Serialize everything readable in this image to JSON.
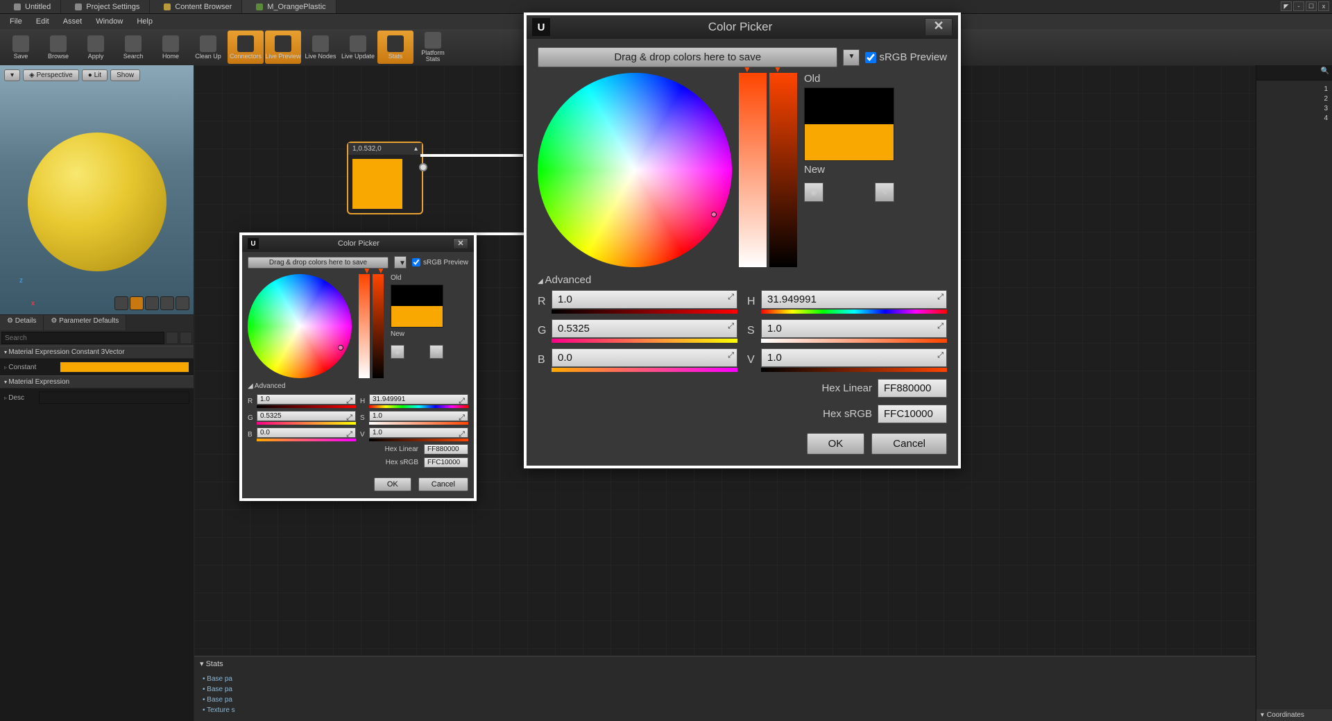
{
  "tabs": [
    {
      "label": "Untitled"
    },
    {
      "label": "Project Settings"
    },
    {
      "label": "Content Browser"
    },
    {
      "label": "M_OrangePlastic"
    }
  ],
  "menu": [
    "File",
    "Edit",
    "Asset",
    "Window",
    "Help"
  ],
  "toolbar": [
    {
      "label": "Save"
    },
    {
      "label": "Browse"
    },
    {
      "label": "Apply"
    },
    {
      "label": "Search"
    },
    {
      "label": "Home"
    },
    {
      "label": "Clean Up"
    },
    {
      "label": "Connectors",
      "active": true
    },
    {
      "label": "Live Preview",
      "active": true
    },
    {
      "label": "Live Nodes"
    },
    {
      "label": "Live Update"
    },
    {
      "label": "Stats",
      "active": true
    },
    {
      "label": "Platform Stats"
    }
  ],
  "viewport": {
    "perspective": "Perspective",
    "lit": "Lit",
    "show": "Show"
  },
  "detailsTabs": [
    "Details",
    "Parameter Defaults"
  ],
  "search_placeholder": "Search",
  "sections": {
    "vec3": "Material Expression Constant 3Vector",
    "constant": "Constant",
    "expr": "Material Expression",
    "desc": "Desc"
  },
  "node": {
    "title": "1,0.532,0"
  },
  "stats": {
    "header": "Stats",
    "items": [
      "Base pa",
      "Base pa",
      "Base pa",
      "Texture s"
    ]
  },
  "right": {
    "nums": [
      "1",
      "2",
      "3",
      "4"
    ],
    "coords": "Coordinates"
  },
  "picker": {
    "title": "Color Picker",
    "drop": "Drag & drop colors here to save",
    "srgb": "sRGB Preview",
    "old": "Old",
    "new": "New",
    "advanced": "Advanced",
    "r": "R",
    "g": "G",
    "b": "B",
    "h": "H",
    "s": "S",
    "v": "V",
    "rVal": "1.0",
    "gVal": "0.5325",
    "bVal": "0.0",
    "hVal": "31.949991",
    "sVal": "1.0",
    "vVal": "1.0",
    "hexLinLbl": "Hex Linear",
    "hexLin": "FF880000",
    "hexSrgbLbl": "Hex sRGB",
    "hexSrgb": "FFC10000",
    "ok": "OK",
    "cancel": "Cancel"
  }
}
